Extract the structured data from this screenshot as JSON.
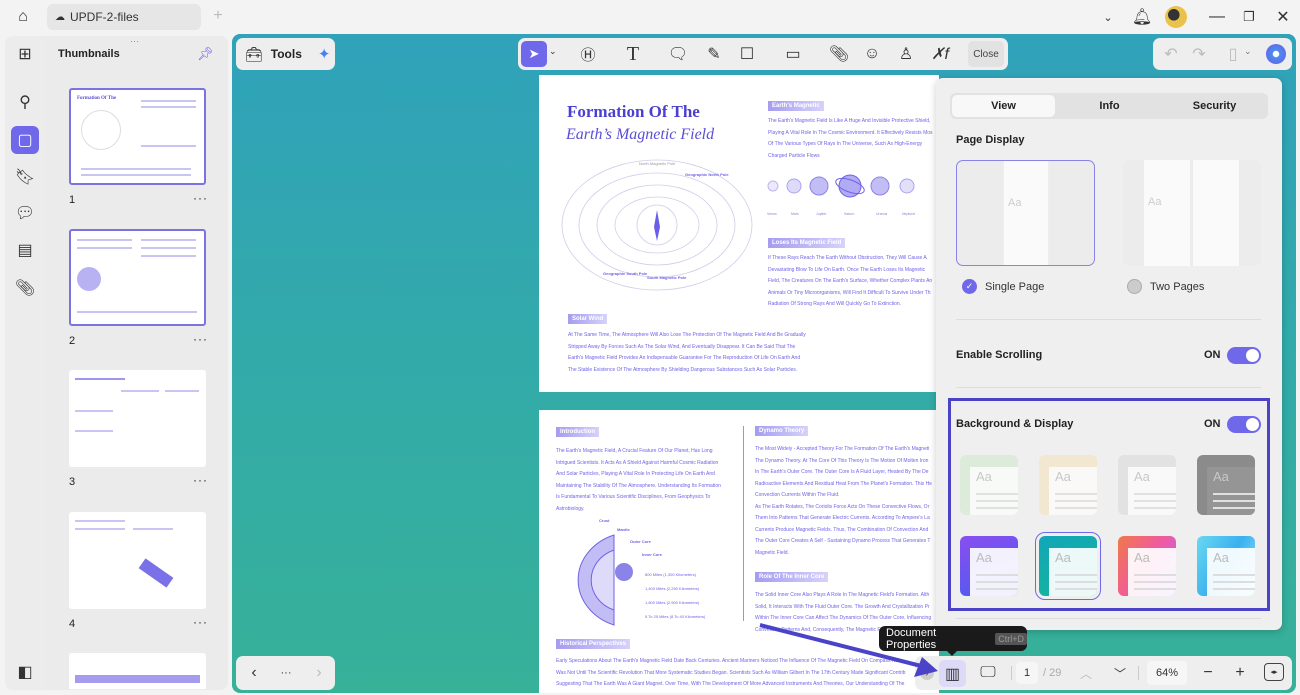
{
  "titlebar": {
    "tab_title": "UPDF-2-files",
    "add_tab": "+",
    "icons": [
      "home-icon",
      "cloud-icon",
      "chevron-down-icon",
      "bell-icon",
      "avatar",
      "minimize-icon",
      "restore-icon",
      "close-icon"
    ]
  },
  "sidebar": {
    "title": "Thumbnails",
    "pages": [
      {
        "num": "1"
      },
      {
        "num": "2"
      },
      {
        "num": "3"
      },
      {
        "num": "4"
      }
    ],
    "more": "···"
  },
  "toolbar": {
    "tools_label": "Tools",
    "close_label": "Close"
  },
  "page1": {
    "title_line1": "Formation Of The",
    "title_line2": "Earth’s Magnetic Field",
    "diagram_labels": {
      "north_mag": "North Magnetic Pole",
      "geo_north": "Geographic North Pole",
      "geo_south": "Geographic South Pole",
      "south_mag": "South Magnetic Pole"
    },
    "s1_head": "Earth's Magnetic",
    "s1_lines": [
      "The Earth's Magnetic Field Is Like A Huge And Invisible Protective Shield,",
      "Playing A Vital Role In The Cosmic Environment. It Effectively Resists Mos",
      "Of The Various Types Of Rays In The Universe, Such As High-Energy",
      "Charged Particle Flows"
    ],
    "planets": [
      "Venus",
      "Mars",
      "Jupiter",
      "Saturn",
      "Uranus",
      "Neptune"
    ],
    "s2_head": "Loses Its Magnetic Field",
    "s2_lines": [
      "If These Rays Reach The Earth Without Obstruction, They Will Cause A",
      "Devastating Blow To Life On Earth. Once The Earth Loses Its Magnetic",
      "Field, The Creatures On The Earth's Surface, Whether Complex Plants An",
      "Animals Or Tiny Microorganisms, Will Find It Difficult To Survive Under Th",
      "Radiation Of Strong Rays And Will Quickly Go To Extinction."
    ],
    "s3_head": "Solar Wind",
    "s3_lines": [
      "At The Same Time, The Atmosphere Will Also Lose The Protection Of The Magnetic Field And Be Gradually",
      "Stripped Away By Forces Such As The Solar Wind, And Eventually Disappear. It Can Be Said That The",
      "Earth's Magnetic Field Provides An Indispensable Guarantee For The Reproduction Of Life On Earth And",
      "The Stable Existence Of The Atmosphere By Shielding Dangerous Substances Such As Solar Particles."
    ]
  },
  "page2": {
    "intro_head": "Introduction",
    "intro_lines": [
      "The Earth's Magnetic Field, A Crucial Feature Of Our Planet, Has Long",
      "Intrigued Scientists. It Acts As A Shield Against Harmful Cosmic Radiation",
      "And Solar Particles, Playing A Vital Role In Protecting Life On Earth And",
      "Maintaining The Stability Of The Atmosphere. Understanding Its Formation",
      "Is Fundamental To Various Scientific Disciplines, From Geophysics To",
      "Astrobiology."
    ],
    "layers": [
      "Crust",
      "Mantle",
      "Outer Core",
      "Inner Core"
    ],
    "depths": [
      "800 Miles (1,300 Kilometers)",
      "1,400 Miles (2,250 Kilometers)",
      "1,800 Miles (2,900 Kilometers)",
      "5 To 25 Miles (8 To 40 Kilometers)"
    ],
    "dyn_head": "Dynamo Theory",
    "dyn_lines": [
      "The Most Widely - Accepted Theory For The Formation Of The Earth's Magneti",
      "The Dynamo Theory. At The Core Of This Theory Is The Motion Of Molten Iron",
      "In The Earth's Outer Core. The Outer Core Is A Fluid Layer, Heated By The De",
      "Radioactive Elements And Residual Heat From The Planet's Formation. This He",
      "Convection Currents Within The Fluid.",
      "As The Earth Rotates, The Coriolis Force Acts On These Convective Flows, Or",
      "Them Into Patterns That Generate Electric Currents. According To Ampere's La",
      "Currents Produce Magnetic Fields. Thus, The Combination Of Convection And",
      "The Outer Core Creates A Self - Sustaining Dynamo Process That Generates T",
      "Magnetic Field."
    ],
    "role_head": "Role Of The Inner Core",
    "role_lines": [
      "The Solid Inner Core Also Plays A Role In The Magnetic Field's Formation. Alth",
      "Solid, It Interacts With The Fluid Outer Core. The Growth And Crystallization Pr",
      "Within The Inner Core Can Affect The Dynamics Of The Outer Core, Influencing",
      "Convection Patterns And, Consequently, The Magnetic Field."
    ],
    "hist_head": "Historical Perspectives",
    "hist_lines": [
      "Early Speculations About The Earth's Magnetic Field Date Back Centuries. Ancient Mariners Noticed The Influence Of The Magnetic Field On Compass Nee",
      "Was Not Until The Scientific Revolution That More Systematic Studies Began. Scientists Such As William Gilbert In The 17th Century Made Significant Contrib",
      "Suggesting That The Earth Was A Giant Magnet. Over Time, With The Development Of More Advanced Instruments And Theories, Our Understanding Of The"
    ]
  },
  "properties": {
    "tabs": [
      "View",
      "Info",
      "Security"
    ],
    "active_tab": "View",
    "page_display_label": "Page Display",
    "single_page": "Single Page",
    "two_pages": "Two Pages",
    "selected_display": "Single Page",
    "enable_scrolling": "Enable Scrolling",
    "scrolling_state": "ON",
    "bg_display": "Background & Display",
    "bg_state": "ON",
    "swatch_sample": "Aa",
    "swatches": [
      "green",
      "beige",
      "light-gray",
      "dark-gray",
      "purple-gradient",
      "teal-gradient",
      "sunset-gradient",
      "sky-gradient"
    ],
    "selected_swatch": "teal-gradient"
  },
  "tooltip": {
    "text": "Document Properties",
    "shortcut": "Ctrl+D"
  },
  "bottombar": {
    "page": "1",
    "total": "/ 29",
    "zoom": "64%",
    "left_more": "···"
  },
  "colors": {
    "accent": "#7068ea",
    "canvas_top": "#30a2ba",
    "canvas_bottom": "#37b198",
    "highlight_box": "#4a43c8",
    "pdf_text": "#6f63e6"
  }
}
